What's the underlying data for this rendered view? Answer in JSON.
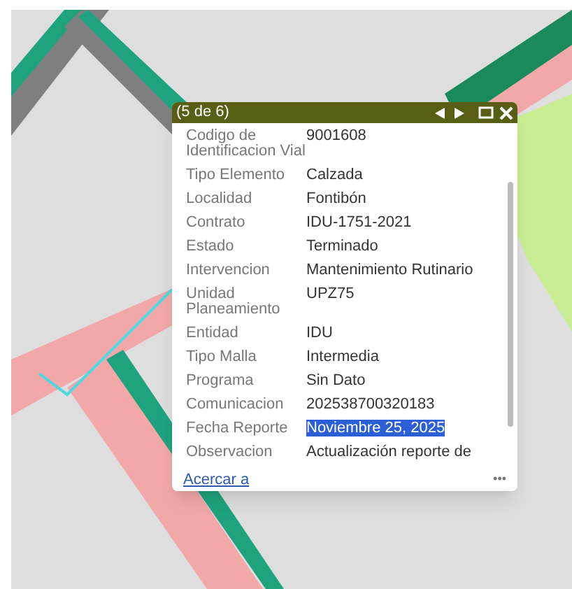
{
  "popup": {
    "title": "(5 de 6)",
    "fields": [
      {
        "label": "Codigo de Identificacion Vial",
        "value": "9001608",
        "highlighted": false
      },
      {
        "label": "Tipo Elemento",
        "value": "Calzada",
        "highlighted": false
      },
      {
        "label": "Localidad",
        "value": "Fontibón",
        "highlighted": false
      },
      {
        "label": "Contrato",
        "value": "IDU-1751-2021",
        "highlighted": false
      },
      {
        "label": "Estado",
        "value": "Terminado",
        "highlighted": false
      },
      {
        "label": "Intervencion",
        "value": "Mantenimiento Rutinario",
        "highlighted": false
      },
      {
        "label": "Unidad Planeamiento",
        "value": "UPZ75",
        "highlighted": false
      },
      {
        "label": "Entidad",
        "value": "IDU",
        "highlighted": false
      },
      {
        "label": "Tipo Malla",
        "value": "Intermedia",
        "highlighted": false
      },
      {
        "label": "Programa",
        "value": "Sin Dato",
        "highlighted": false
      },
      {
        "label": "Comunicacion",
        "value": "202538700320183",
        "highlighted": false
      },
      {
        "label": "Fecha Reporte",
        "value": "Noviembre 25, 2025",
        "highlighted": true
      },
      {
        "label": "Observacion",
        "value": "Actualización reporte de",
        "highlighted": false
      }
    ],
    "link": "Acercar a",
    "more": "•••"
  }
}
